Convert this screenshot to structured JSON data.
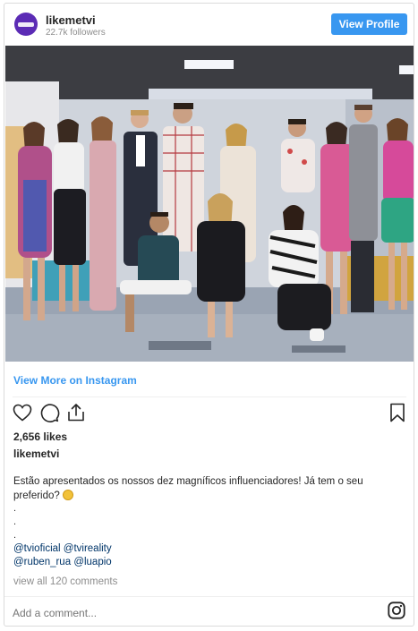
{
  "header": {
    "username": "likemetvi",
    "followers": "22.7k followers",
    "view_profile": "View Profile",
    "avatar_color": "#5b2bb5"
  },
  "post": {
    "image_icon": "group-photo",
    "view_more": "View More on Instagram",
    "likes": "2,656 likes",
    "caption_user": "likemetvi",
    "caption_line1": "Estão apresentados os nossos dez magníficos influenciadores! Já tem o seu",
    "caption_line2": "preferido?",
    "dots": [
      ".",
      ".",
      "."
    ],
    "mentions_line1": [
      "@tvioficial",
      "@tvireality"
    ],
    "mentions_line2": [
      "@ruben_rua",
      "@luapio"
    ],
    "comments": "view all 120 comments",
    "add_comment_placeholder": "Add a comment..."
  },
  "icons": {
    "like": "heart-icon",
    "comment": "comment-icon",
    "share": "share-icon",
    "save": "bookmark-icon",
    "brand": "instagram-icon"
  },
  "colors": {
    "accent": "#3897f0",
    "link": "#003569",
    "muted": "#8e8e8e"
  }
}
